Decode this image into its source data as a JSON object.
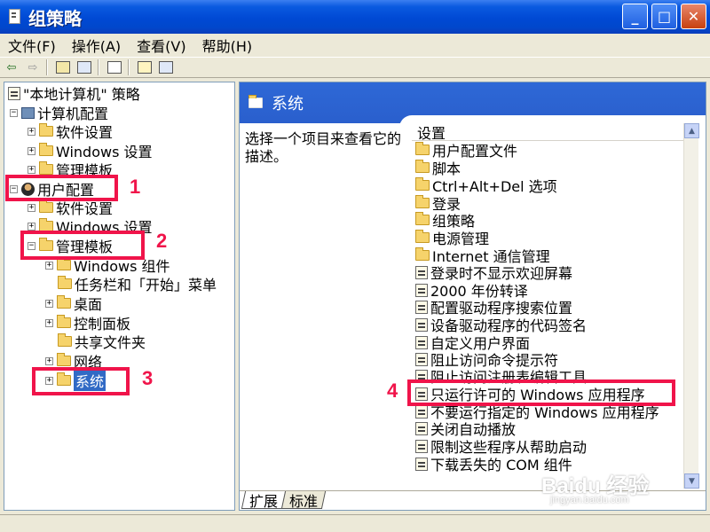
{
  "window": {
    "title": "组策略",
    "btn_min": "_",
    "btn_max": "□",
    "btn_close": "✕"
  },
  "menu": [
    "文件(F)",
    "操作(A)",
    "查看(V)",
    "帮助(H)"
  ],
  "toolbar": {
    "back": "⇦",
    "forward": "⇨"
  },
  "tree": {
    "root": "\"本地计算机\" 策略",
    "items": [
      "计算机配置",
      "软件设置",
      "Windows 设置",
      "管理模板",
      "用户配置",
      "软件设置",
      "Windows 设置",
      "管理模板",
      "Windows 组件",
      "任务栏和「开始」菜单",
      "桌面",
      "控制面板",
      "共享文件夹",
      "网络",
      "系统"
    ]
  },
  "right": {
    "header_title": "系统",
    "description": "选择一个项目来查看它的描述。",
    "column_header": "设置",
    "folders": [
      "用户配置文件",
      "脚本",
      "Ctrl+Alt+Del 选项",
      "登录",
      "组策略",
      "电源管理",
      "Internet 通信管理"
    ],
    "policies": [
      "登录时不显示欢迎屏幕",
      "2000 年份转译",
      "配置驱动程序搜索位置",
      "设备驱动程序的代码签名",
      "自定义用户界面",
      "阻止访问命令提示符",
      "阻止访问注册表编辑工具",
      "只运行许可的 Windows 应用程序",
      "不要运行指定的 Windows 应用程序",
      "关闭自动播放",
      "限制这些程序从帮助启动",
      "下载丢失的 COM 组件"
    ],
    "tabs": [
      "扩展",
      "标准"
    ]
  },
  "annotations": [
    "1",
    "2",
    "3",
    "4"
  ],
  "watermark": {
    "main": "Baidu 经验",
    "sub": "jingyan.baidu.com"
  }
}
